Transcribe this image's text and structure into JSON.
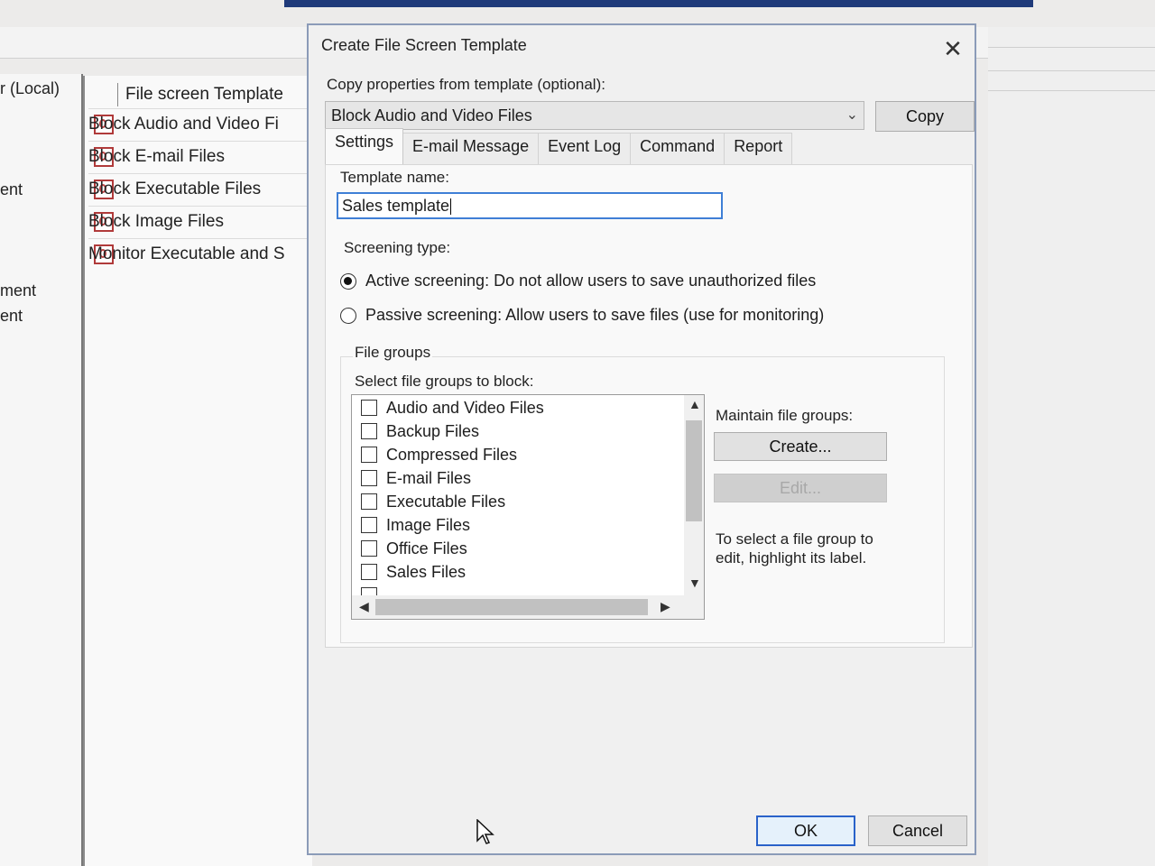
{
  "background": {
    "left_labels": [
      "r (Local)",
      "ent",
      "ment",
      "ent"
    ],
    "list_header": "File screen Template",
    "list_items": [
      "Block Audio and Video Fi",
      "Block E-mail Files",
      "Block Executable Files",
      "Block Image Files",
      "Monitor Executable and S"
    ]
  },
  "dialog": {
    "title": "Create File Screen Template",
    "copy_label": "Copy properties from template (optional):",
    "copy_selected": "Block Audio and Video Files",
    "copy_button": "Copy",
    "tabs": [
      "Settings",
      "E-mail Message",
      "Event Log",
      "Command",
      "Report"
    ],
    "template_name_label": "Template name:",
    "template_name_value": "Sales template",
    "screening_type_label": "Screening type:",
    "active_screening": "Active screening: Do not allow users to save unauthorized files",
    "passive_screening": "Passive screening: Allow users to save files (use for monitoring)",
    "file_groups_label": "File groups",
    "select_groups_label": "Select file groups to block:",
    "file_groups": [
      "Audio and Video Files",
      "Backup Files",
      "Compressed Files",
      "E-mail Files",
      "Executable Files",
      "Image Files",
      "Office Files",
      "Sales Files"
    ],
    "maintain_label": "Maintain file groups:",
    "create_button": "Create...",
    "edit_button": "Edit...",
    "hint_line1": "To select a file group to",
    "hint_line2": "edit, highlight its label.",
    "ok_button": "OK",
    "cancel_button": "Cancel"
  }
}
